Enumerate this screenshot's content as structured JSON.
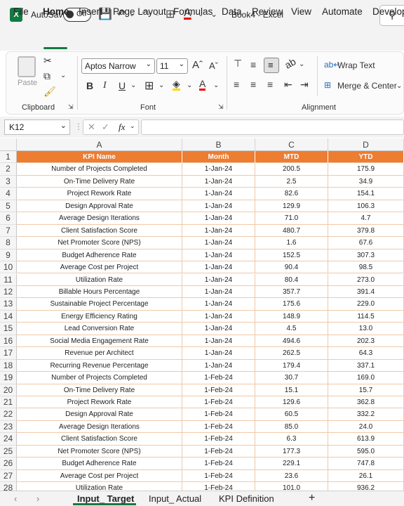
{
  "titlebar": {
    "app_logo": "X",
    "autosave_label": "AutoSave",
    "autosave_state": "Off",
    "document_title": "Book4  -  Excel",
    "icons": [
      "save-icon",
      "undo-icon",
      "redo-icon",
      "borders-icon",
      "font-color-icon",
      "search-icon"
    ]
  },
  "menu": {
    "items": [
      "File",
      "Home",
      "Insert",
      "Page Layout",
      "Formulas",
      "Data",
      "Review",
      "View",
      "Automate",
      "Develop"
    ],
    "active": "Home"
  },
  "ribbon": {
    "clipboard": {
      "label": "Clipboard",
      "paste": "Paste"
    },
    "font": {
      "label": "Font",
      "family": "Aptos Narrow",
      "size": "11"
    },
    "alignment": {
      "label": "Alignment",
      "wrap_text": "Wrap Text",
      "merge_center": "Merge & Center"
    }
  },
  "formula_bar": {
    "name_box": "K12",
    "fx": "fx",
    "value": ""
  },
  "columns": [
    "A",
    "B",
    "C",
    "D"
  ],
  "header_row": [
    "KPI Name",
    "Month",
    "MTD",
    "YTD"
  ],
  "rows": [
    [
      "Number of Projects Completed",
      "1-Jan-24",
      "200.5",
      "175.9"
    ],
    [
      "On-Time Delivery Rate",
      "1-Jan-24",
      "2.5",
      "34.9"
    ],
    [
      "Project Rework Rate",
      "1-Jan-24",
      "82.6",
      "154.1"
    ],
    [
      "Design Approval Rate",
      "1-Jan-24",
      "129.9",
      "106.3"
    ],
    [
      "Average Design Iterations",
      "1-Jan-24",
      "71.0",
      "4.7"
    ],
    [
      "Client Satisfaction Score",
      "1-Jan-24",
      "480.7",
      "379.8"
    ],
    [
      "Net Promoter Score (NPS)",
      "1-Jan-24",
      "1.6",
      "67.6"
    ],
    [
      "Budget Adherence Rate",
      "1-Jan-24",
      "152.5",
      "307.3"
    ],
    [
      "Average Cost per Project",
      "1-Jan-24",
      "90.4",
      "98.5"
    ],
    [
      "Utilization Rate",
      "1-Jan-24",
      "80.4",
      "273.0"
    ],
    [
      "Billable Hours Percentage",
      "1-Jan-24",
      "357.7",
      "391.4"
    ],
    [
      "Sustainable Project Percentage",
      "1-Jan-24",
      "175.6",
      "229.0"
    ],
    [
      "Energy Efficiency Rating",
      "1-Jan-24",
      "148.9",
      "114.5"
    ],
    [
      "Lead Conversion Rate",
      "1-Jan-24",
      "4.5",
      "13.0"
    ],
    [
      "Social Media Engagement Rate",
      "1-Jan-24",
      "494.6",
      "202.3"
    ],
    [
      "Revenue per Architect",
      "1-Jan-24",
      "262.5",
      "64.3"
    ],
    [
      "Recurring Revenue Percentage",
      "1-Jan-24",
      "179.4",
      "337.1"
    ],
    [
      "Number of Projects Completed",
      "1-Feb-24",
      "30.7",
      "169.0"
    ],
    [
      "On-Time Delivery Rate",
      "1-Feb-24",
      "15.1",
      "15.7"
    ],
    [
      "Project Rework Rate",
      "1-Feb-24",
      "129.6",
      "362.8"
    ],
    [
      "Design Approval Rate",
      "1-Feb-24",
      "60.5",
      "332.2"
    ],
    [
      "Average Design Iterations",
      "1-Feb-24",
      "85.0",
      "24.0"
    ],
    [
      "Client Satisfaction Score",
      "1-Feb-24",
      "6.3",
      "613.9"
    ],
    [
      "Net Promoter Score (NPS)",
      "1-Feb-24",
      "177.3",
      "595.0"
    ],
    [
      "Budget Adherence Rate",
      "1-Feb-24",
      "229.1",
      "747.8"
    ],
    [
      "Average Cost per Project",
      "1-Feb-24",
      "23.6",
      "26.1"
    ],
    [
      "Utilization Rate",
      "1-Feb-24",
      "101.0",
      "936.2"
    ]
  ],
  "sheets": {
    "tabs": [
      "Input_ Target",
      "Input_ Actual",
      "KPI Definition"
    ],
    "active": "Input_ Target",
    "add": "+"
  },
  "colors": {
    "accent": "#107c41",
    "header_fill": "#ed7d31",
    "border": "#f0c9a8"
  }
}
